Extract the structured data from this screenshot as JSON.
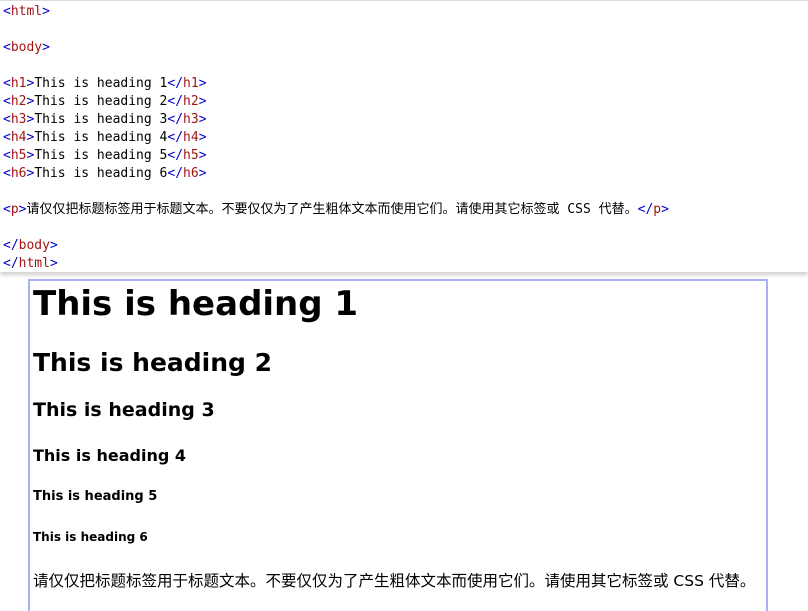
{
  "colors": {
    "tag_name": "#a31515",
    "angle_bracket": "#0000cc",
    "text": "#000000",
    "preview_border": "#aab0f3"
  },
  "code": {
    "html_open": "html",
    "body_open": "body",
    "h1_tag": "h1",
    "h1_text": "This is heading 1",
    "h2_tag": "h2",
    "h2_text": "This is heading 2",
    "h3_tag": "h3",
    "h3_text": "This is heading 3",
    "h4_tag": "h4",
    "h4_text": "This is heading 4",
    "h5_tag": "h5",
    "h5_text": "This is heading 5",
    "h6_tag": "h6",
    "h6_text": "This is heading 6",
    "p_tag": "p",
    "p_text": "请仅仅把标题标签用于标题文本。不要仅仅为了产生粗体文本而使用它们。请使用其它标签或 CSS 代替。",
    "body_close": "body",
    "html_close": "html"
  },
  "preview": {
    "h1": "This is heading 1",
    "h2": "This is heading 2",
    "h3": "This is heading 3",
    "h4": "This is heading 4",
    "h5": "This is heading 5",
    "h6": "This is heading 6",
    "p": "请仅仅把标题标签用于标题文本。不要仅仅为了产生粗体文本而使用它们。请使用其它标签或 CSS 代替。"
  }
}
